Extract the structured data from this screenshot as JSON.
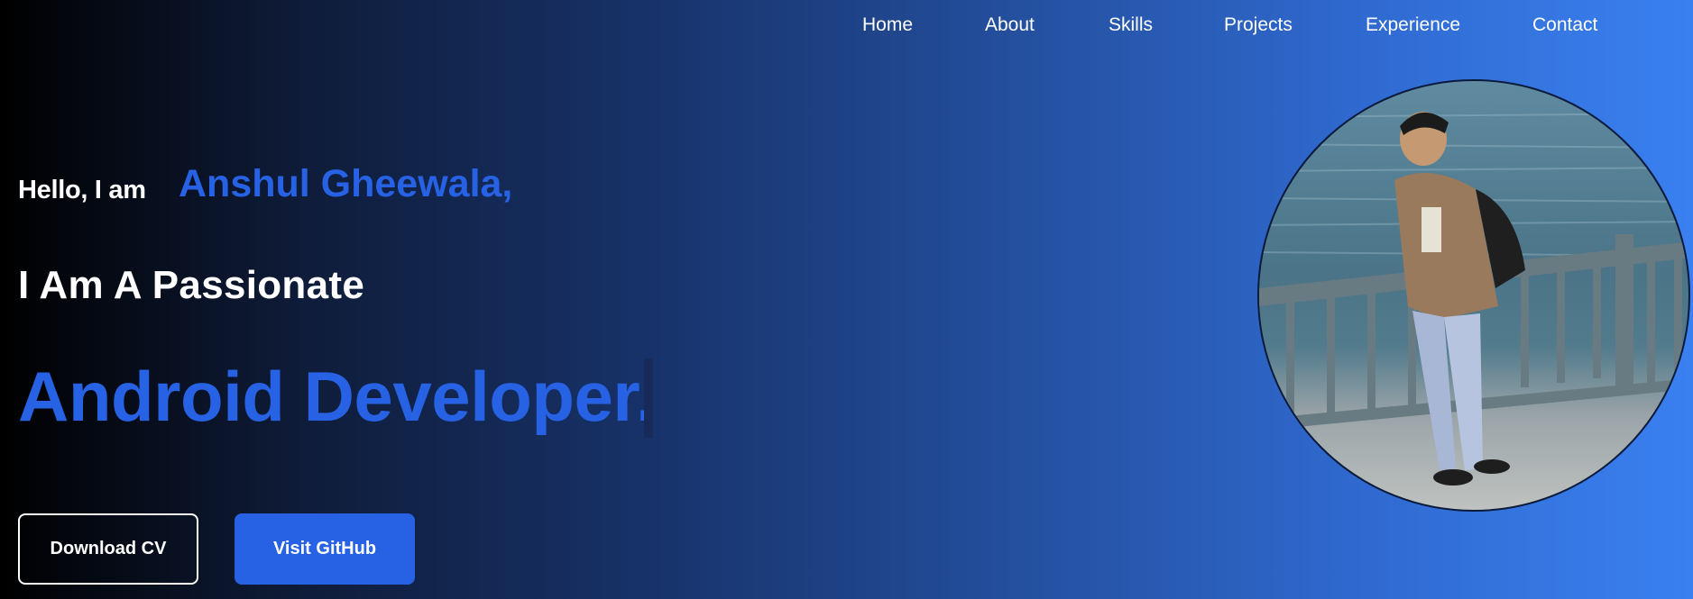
{
  "nav": {
    "items": [
      "Home",
      "About",
      "Skills",
      "Projects",
      "Experience",
      "Contact"
    ]
  },
  "hero": {
    "greeting": "Hello, I am",
    "name": "Anshul Gheewala,",
    "tagline": "I Am A Passionate",
    "role": "Android Developer."
  },
  "buttons": {
    "download_cv": "Download CV",
    "visit_github": "Visit GitHub"
  },
  "colors": {
    "accent": "#2662e3",
    "background_start": "#000000",
    "background_end": "#3a80f0"
  }
}
